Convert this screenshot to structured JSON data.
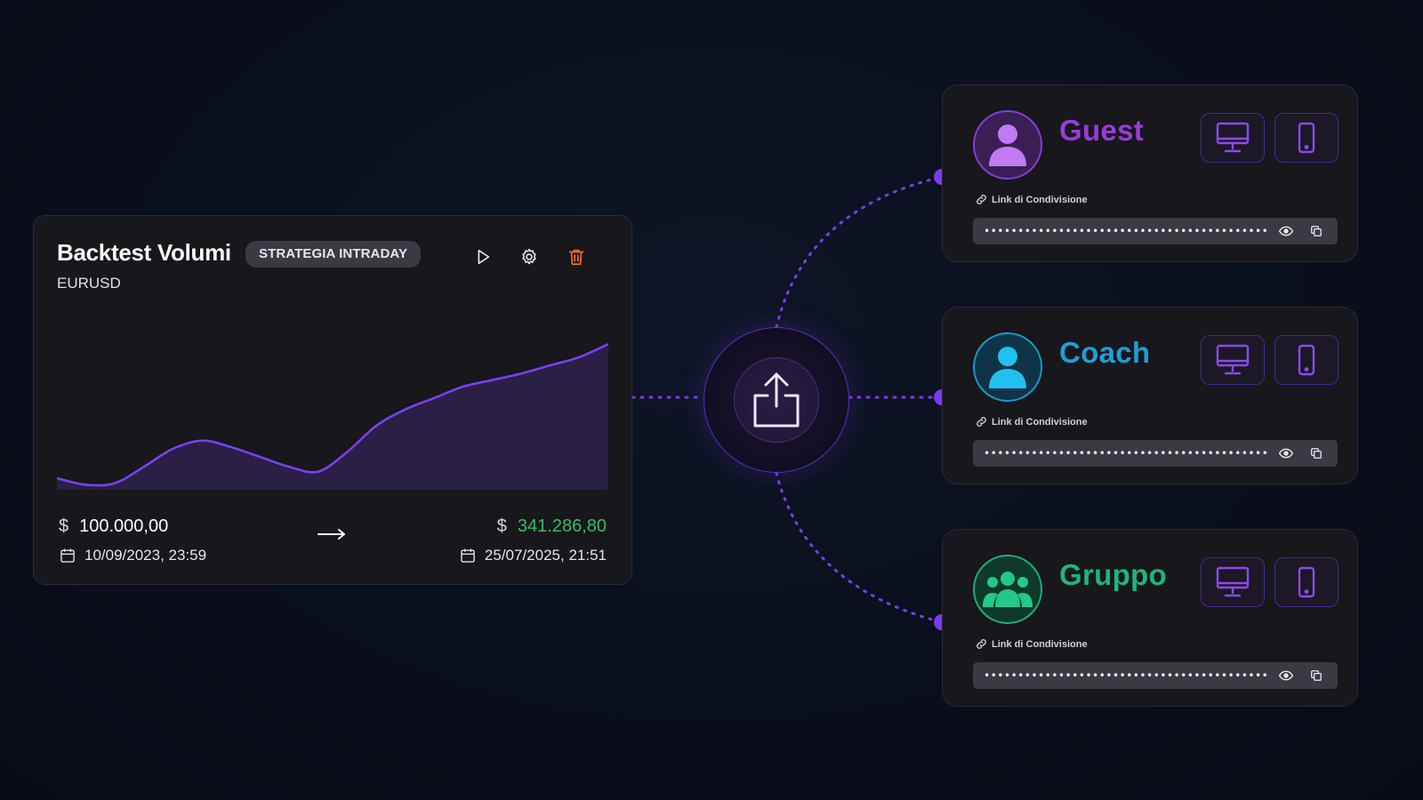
{
  "backtest": {
    "title": "Backtest Volumi",
    "badge": "STRATEGIA INTRADAY",
    "symbol": "EURUSD",
    "start_currency": "$",
    "start_value": "100.000,00",
    "start_date": "10/09/2023, 23:59",
    "end_currency": "$",
    "end_value": "341.286,80",
    "end_date": "25/07/2025, 21:51",
    "icons": [
      "play-icon",
      "gear-icon",
      "trash-icon",
      "calendar-icon",
      "arrow-right-icon"
    ],
    "colors": {
      "accent": "#7c3aed",
      "positive": "#2fbf64",
      "delete": "#f26b2a"
    }
  },
  "chart_data": {
    "type": "area",
    "x": [
      0,
      1,
      2,
      3,
      4,
      5,
      6,
      7,
      8,
      9,
      10,
      11,
      12,
      13,
      14,
      15,
      16,
      17,
      18,
      19
    ],
    "values": [
      6,
      2,
      3,
      13,
      24,
      29,
      25,
      19,
      13,
      10,
      22,
      38,
      48,
      55,
      62,
      66,
      70,
      75,
      80,
      88
    ],
    "ylim": [
      0,
      100
    ],
    "grid": false,
    "line_color": "#7b3ff2",
    "fill_color": "#2a1f44"
  },
  "hub": {
    "icon": "share-upload-icon"
  },
  "share_targets": [
    {
      "name": "Guest",
      "color": "#9b3bd8",
      "avatar_icon": "user-icon",
      "avatar_bg": "#3a1f55",
      "avatar_fg": "#c07af2",
      "link_label": "Link di Condivisione",
      "link_value": "••••••••••••••••••••••••••••••••••••••••••••••••"
    },
    {
      "name": "Coach",
      "color": "#1e9fd6",
      "avatar_icon": "user-icon",
      "avatar_bg": "#103447",
      "avatar_fg": "#20c1f0",
      "link_label": "Link di Condivisione",
      "link_value": "••••••••••••••••••••••••••••••••••••••••••••••••"
    },
    {
      "name": "Gruppo",
      "color": "#1fb57a",
      "avatar_icon": "group-icon",
      "avatar_bg": "#0f3a2a",
      "avatar_fg": "#22c98a",
      "link_label": "Link di Condivisione",
      "link_value": "••••••••••••••••••••••••••••••••••••••••••••••••"
    }
  ],
  "device_icons": [
    "desktop-icon",
    "mobile-icon"
  ],
  "field_icons": [
    "link-icon",
    "eye-icon",
    "copy-icon"
  ]
}
